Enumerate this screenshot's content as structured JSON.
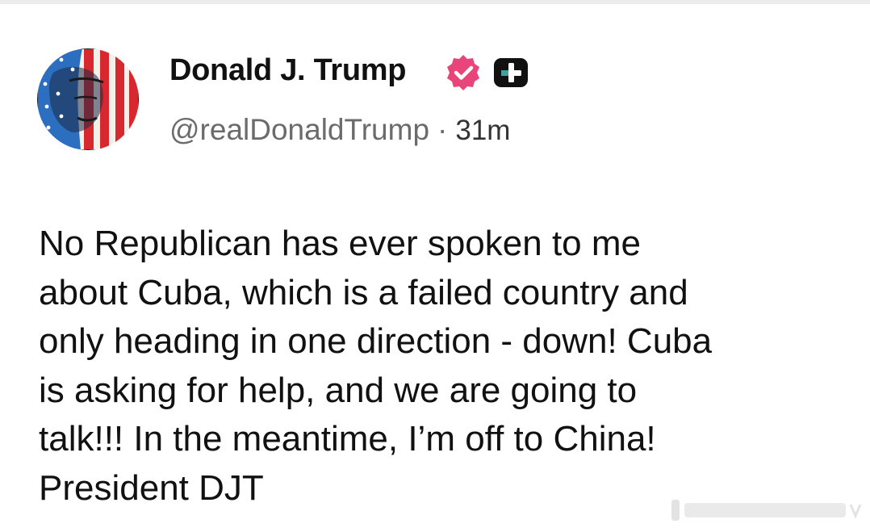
{
  "post": {
    "author": {
      "display_name": "Donald J. Trump",
      "handle": "@realDonaldTrump",
      "verified_icon": "verified-badge-icon",
      "verified_color": "#e8457a",
      "plus_icon": "plus-badge-icon"
    },
    "separator": "·",
    "time": "31m",
    "text": "No Republican has ever spoken to me\nabout Cuba, which is a failed country and\nonly heading in one direction - down! Cuba\nis asking for help, and we are going to\ntalk!!! In the meantime, I’m off to China!\nPresident DJT"
  },
  "colors": {
    "text": "#111111",
    "meta": "#6b6b6b",
    "background": "#ffffff"
  }
}
